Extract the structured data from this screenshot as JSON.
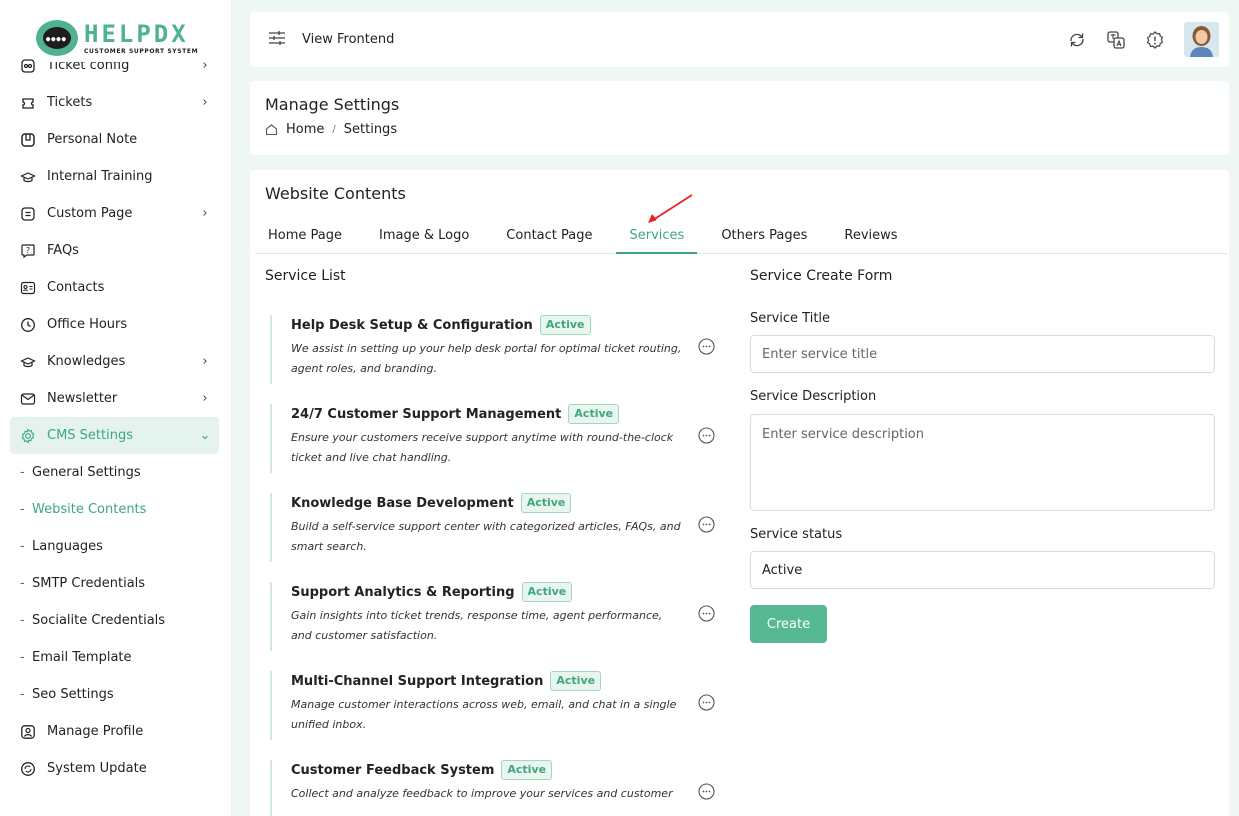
{
  "brand": {
    "name": "HELPDX",
    "tagline": "CUSTOMER SUPPORT SYSTEM",
    "accent": "#4fb38f"
  },
  "sidebar": {
    "items": [
      {
        "label": "Ticket config",
        "icon": "ticket-config-icon",
        "chevron": "›"
      },
      {
        "label": "Tickets",
        "icon": "ticket-icon",
        "chevron": "›"
      },
      {
        "label": "Personal Note",
        "icon": "note-icon",
        "chevron": ""
      },
      {
        "label": "Internal Training",
        "icon": "graduation-icon",
        "chevron": ""
      },
      {
        "label": "Custom Page",
        "icon": "page-icon",
        "chevron": "›"
      },
      {
        "label": "FAQs",
        "icon": "faq-icon",
        "chevron": ""
      },
      {
        "label": "Contacts",
        "icon": "contact-card-icon",
        "chevron": ""
      },
      {
        "label": "Office Hours",
        "icon": "clock-icon",
        "chevron": ""
      },
      {
        "label": "Knowledges",
        "icon": "knowledge-icon",
        "chevron": "›"
      },
      {
        "label": "Newsletter",
        "icon": "mail-icon",
        "chevron": "›"
      },
      {
        "label": "CMS Settings",
        "icon": "gear-icon",
        "chevron": "⌄"
      }
    ],
    "sub_items": [
      {
        "label": "General Settings"
      },
      {
        "label": "Website Contents"
      },
      {
        "label": "Languages"
      },
      {
        "label": "SMTP Credentials"
      },
      {
        "label": "Socialite Credentials"
      },
      {
        "label": "Email Template"
      },
      {
        "label": "Seo Settings"
      }
    ],
    "bottom_items": [
      {
        "label": "Manage Profile",
        "icon": "user-icon"
      },
      {
        "label": "System Update",
        "icon": "refresh-icon"
      }
    ],
    "dash": "-"
  },
  "topbar": {
    "view_frontend": "View Frontend"
  },
  "header": {
    "title": "Manage Settings",
    "breadcrumb_home": "Home",
    "breadcrumb_sep": "/",
    "breadcrumb_current": "Settings"
  },
  "content": {
    "title": "Website Contents",
    "tabs": [
      "Home Page",
      "Image & Logo",
      "Contact Page",
      "Services",
      "Others Pages",
      "Reviews"
    ],
    "active_tab": "Services",
    "service_list_title": "Service List",
    "services": [
      {
        "name": "Help Desk Setup & Configuration",
        "status": "Active",
        "description": "We assist in setting up your help desk portal for optimal ticket routing, agent roles, and branding."
      },
      {
        "name": "24/7 Customer Support Management",
        "status": "Active",
        "description": "Ensure your customers receive support anytime with round-the-clock ticket and live chat handling."
      },
      {
        "name": "Knowledge Base Development",
        "status": "Active",
        "description": "Build a self-service support center with categorized articles, FAQs, and smart search."
      },
      {
        "name": "Support Analytics & Reporting",
        "status": "Active",
        "description": "Gain insights into ticket trends, response time, agent performance, and customer satisfaction."
      },
      {
        "name": "Multi-Channel Support Integration",
        "status": "Active",
        "description": "Manage customer interactions across web, email, and chat in a single unified inbox."
      },
      {
        "name": "Customer Feedback System",
        "status": "Active",
        "description": "Collect and analyze feedback to improve your services and customer"
      }
    ],
    "form": {
      "title": "Service Create Form",
      "title_label": "Service Title",
      "title_placeholder": "Enter service title",
      "desc_label": "Service Description",
      "desc_placeholder": "Enter service description",
      "status_label": "Service status",
      "status_value": "Active",
      "submit_label": "Create"
    }
  }
}
